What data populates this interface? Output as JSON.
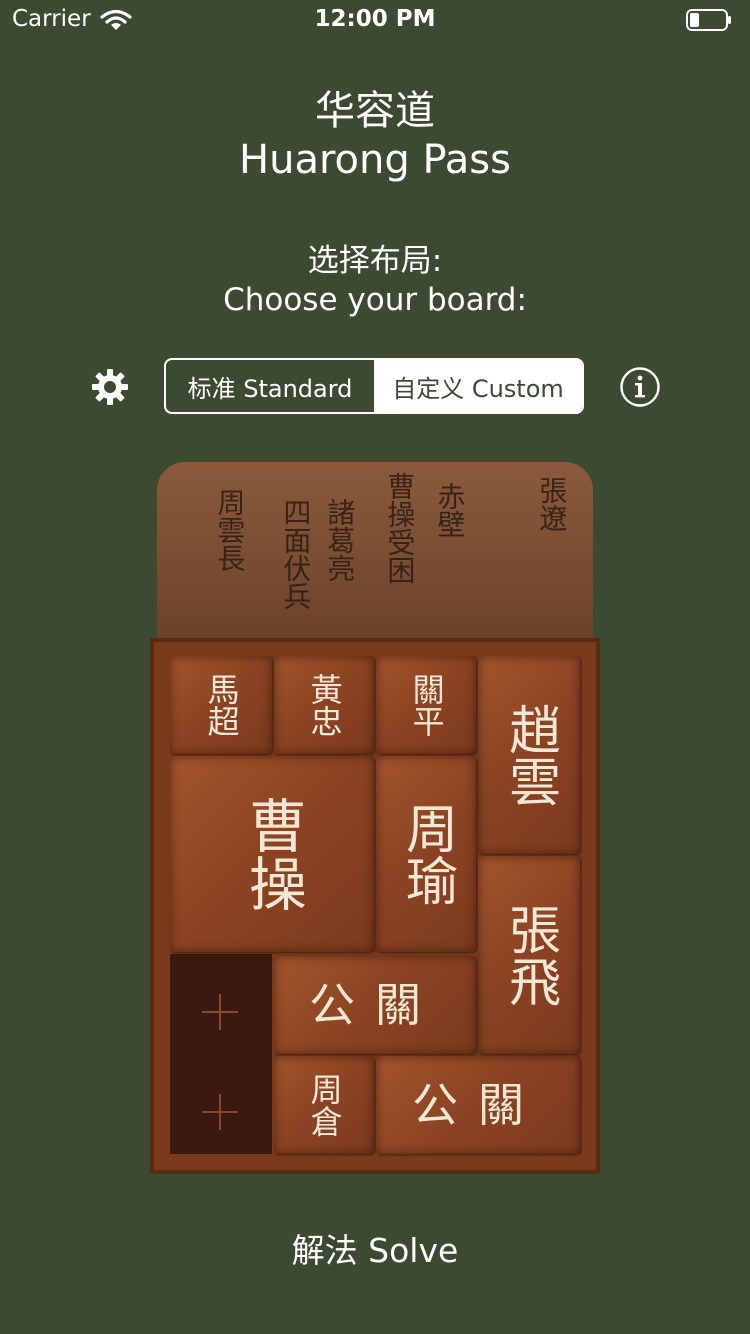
{
  "status_bar": {
    "carrier": "Carrier",
    "time": "12:00 PM"
  },
  "header": {
    "title_zh": "华容道",
    "title_en": "Huarong Pass"
  },
  "prompt": {
    "zh": "选择布局:",
    "en": "Choose your board:"
  },
  "board_selector": {
    "standard_label": "标准 Standard",
    "custom_label": "自定义 Custom",
    "selected": "custom"
  },
  "icons": {
    "settings": "gear-icon",
    "info": "info-icon",
    "empty_slot": "plus-icon"
  },
  "lid_columns": [
    "四面伏兵",
    "諸葛亮",
    "曹操受困",
    "赤壁",
    "張遼",
    "周雲長"
  ],
  "pieces": {
    "ma_chao": "馬超",
    "huang_zhong": "黃忠",
    "guan_ping": "關平",
    "zhao_yun": "趙雲",
    "cao_cao": "曹操",
    "zhou_yu": "周瑜",
    "zhang_fei": "張飛",
    "guan_gong_1": "關公",
    "zhou_cang": "周倉",
    "guan_gong_2": "關公"
  },
  "actions": {
    "solve_label": "解法 Solve"
  },
  "colors": {
    "background": "#3c4a31",
    "text": "#ffffff",
    "wood": "#8c4423"
  }
}
